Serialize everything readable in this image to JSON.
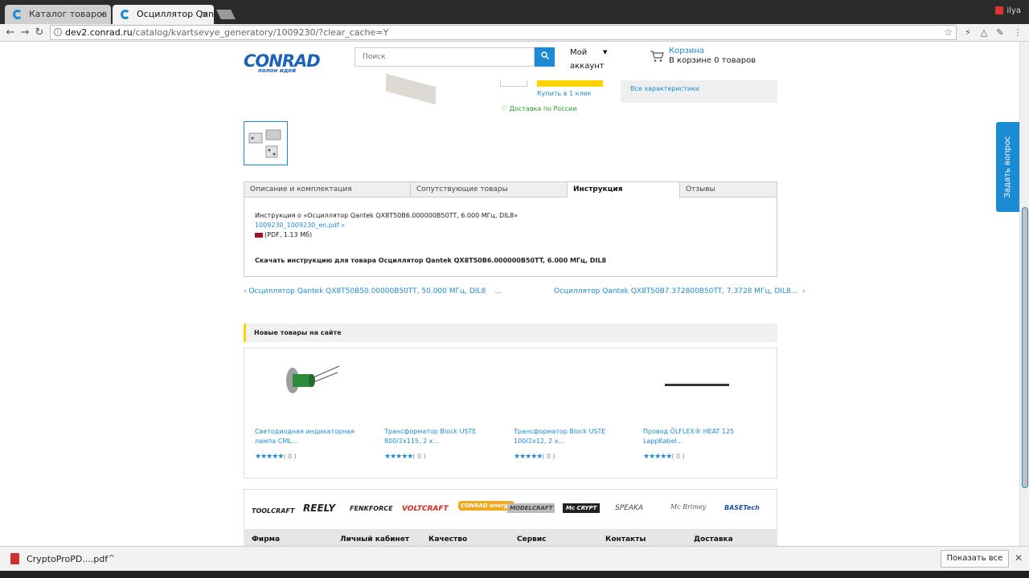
{
  "browser": {
    "tabs": [
      {
        "label": "Каталог товаров"
      },
      {
        "label": "Осциллятор Qantek"
      }
    ],
    "url_host": "dev2.conrad.ru",
    "url_path": "/catalog/kvartsevye_generatory/1009230/?clear_cache=Y",
    "user": "ilya"
  },
  "header": {
    "logo": "CONRAD",
    "logo_slogan": "полон идей",
    "search_placeholder": "Поиск",
    "account_line1": "Мой",
    "account_line2": "аккаунт",
    "cart_title": "Корзина",
    "cart_info": "В корзине 0 товаров"
  },
  "product": {
    "buy_one_click": "Купить в 1 клик",
    "delivery": "Доставка по России",
    "all_characteristics": "Все характеристики"
  },
  "product_tabs": [
    {
      "label": "Описание и комплектация"
    },
    {
      "label": "Сопутствующие товары"
    },
    {
      "label": "Инструкция"
    },
    {
      "label": "Отзывы"
    }
  ],
  "instruction": {
    "title": "Инструкция о «Осциллятор Qantek QX8T50B6.000000B50TT, 6.000 МГц, DIL8»",
    "file_link": "1009230_1009230_en.pdf »",
    "file_info": "(PDF, 1.13 Мб)",
    "download_text": "Скачать инструкцию для товара Осциллятор Qantek QX8T50B6.000000B50TT, 6.000 МГц, DIL8"
  },
  "navigation": {
    "prev": "Осциллятор Qantek QX8T50B50.00000B50TT, 50.000 МГц, DIL8",
    "prev_ellipsis": "...",
    "next": "Осциллятор Qantek QX8T50B7.372800B50TT, 7.3728 МГц, DIL8..."
  },
  "new_products": {
    "title": "Новые товары на сайте",
    "items": [
      {
        "name": "Светодиодная индикаторная лампа CML...",
        "rating": "★★★★★",
        "count": "( 0 )"
      },
      {
        "name": "Трансформатор Block USTE 800/2х115, 2 х...",
        "rating": "★★★★★",
        "count": "( 0 )"
      },
      {
        "name": "Трансформатор Block USTE 100/2х12, 2 х...",
        "rating": "★★★★★",
        "count": "( 0 )"
      },
      {
        "name": "Провод ÖLFLEX® HEAT 125 LappKabel...",
        "rating": "★★★★★",
        "count": "( 0 )"
      }
    ]
  },
  "brands": [
    "TOOLCRAFT",
    "REELY",
    "FENKFORCE",
    "VOLTCRAFT",
    "CONRAD energy",
    "MODELCRAFT",
    "Mc CRYPT",
    "SPEAKA",
    "Mc Brimey",
    "BASETech"
  ],
  "footer": [
    "Фирма",
    "Личный кабинет",
    "Качество",
    "Сервис",
    "Контакты",
    "Доставка"
  ],
  "ask_question": "Задать вопрос",
  "download_shelf": {
    "filename": "CryptoProPD....pdf",
    "show_all": "Показать все"
  },
  "colors": {
    "accent": "#1c8bd6",
    "buy": "#ffd200",
    "logo": "#1a63b8"
  }
}
